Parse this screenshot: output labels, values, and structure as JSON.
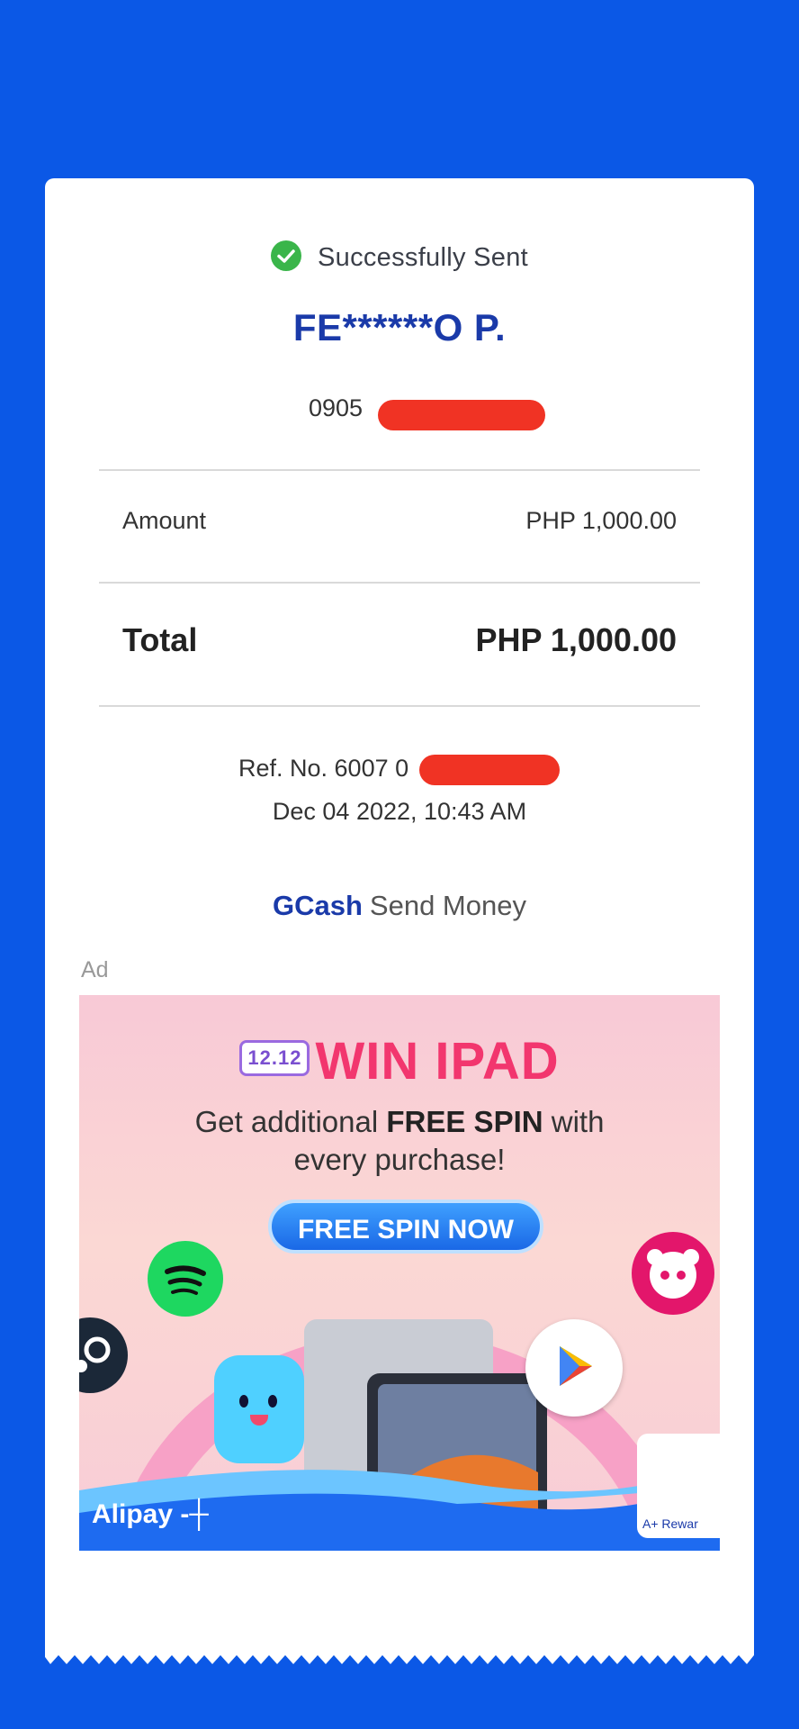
{
  "status": {
    "text": "Successfully Sent",
    "icon": "check-circle-icon",
    "color": "#3ab54a"
  },
  "recipient": {
    "name": "FE******O P.",
    "phone_prefix": "0905"
  },
  "amount": {
    "label": "Amount",
    "value": "PHP 1,000.00"
  },
  "total": {
    "label": "Total",
    "value": "PHP 1,000.00"
  },
  "reference": {
    "text": "Ref. No. 6007 0"
  },
  "datetime": "Dec 04 2022, 10:43 AM",
  "footer": {
    "brand": "GCash",
    "service": "Send Money"
  },
  "ad": {
    "label": "Ad",
    "badge": "12.12",
    "headline": "WIN IPAD",
    "sub_line1_pre": "Get additional ",
    "sub_line1_bold": "FREE SPIN",
    "sub_line1_post": " with",
    "sub_line2": "every purchase!",
    "button": "FREE SPIN NOW",
    "brand": "Alipay",
    "rewards": "A+ Rewar",
    "google_play": "Google Play"
  },
  "colors": {
    "background": "#0b58e6",
    "brand_blue": "#1a3aa9",
    "redaction": "#f03324"
  }
}
